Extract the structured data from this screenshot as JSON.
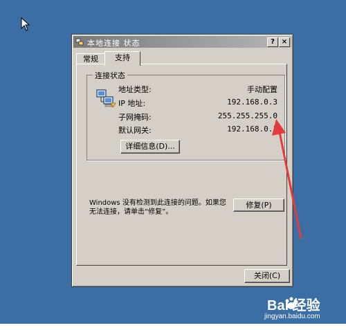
{
  "window": {
    "title": "本地连接 状态",
    "help_label": "?",
    "close_label": "×"
  },
  "tabs": [
    {
      "label": "常规",
      "selected": false
    },
    {
      "label": "支持",
      "selected": true
    }
  ],
  "connection_status": {
    "group_title": "连接状态",
    "rows": [
      {
        "label": "地址类型:",
        "value": "手动配置"
      },
      {
        "label": "IP 地址:",
        "value": "192.168.0.3"
      },
      {
        "label": "子网掩码:",
        "value": "255.255.255.0"
      },
      {
        "label": "默认网关:",
        "value": "192.168.0.1"
      }
    ],
    "details_button": "详细信息(D)..."
  },
  "repair": {
    "message": "Windows 没有检测到此连接的问题。如果您无法连接，请单击“修复”。",
    "button": "修复(P)"
  },
  "footer": {
    "close_button": "关闭(C)"
  },
  "watermark": {
    "brand": "Bai 经验",
    "url": "jingyan.baidu.com"
  },
  "colors": {
    "desktop": "#3a6ea5",
    "dialog_face": "#d4d0c8",
    "title_gradient_start": "#7b7b7b",
    "arrow": "#e23b3b"
  }
}
